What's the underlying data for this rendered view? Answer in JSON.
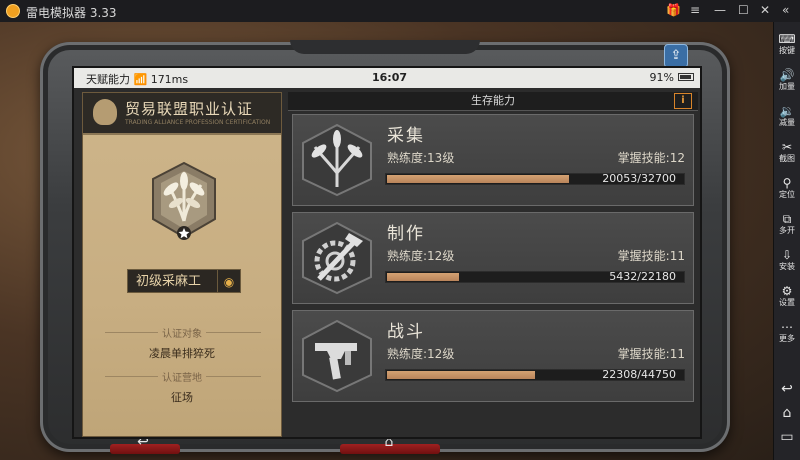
{
  "window": {
    "title": "雷电模拟器 3.33"
  },
  "sidebar": {
    "items": [
      {
        "label": "按键",
        "icon": "keyboard-icon",
        "glyph": "⌨"
      },
      {
        "label": "加量",
        "icon": "volume-up-icon",
        "glyph": "🔊"
      },
      {
        "label": "减量",
        "icon": "volume-down-icon",
        "glyph": "🔉"
      },
      {
        "label": "截图",
        "icon": "scissors-icon",
        "glyph": "✂"
      },
      {
        "label": "定位",
        "icon": "location-pin-icon",
        "glyph": "⚲"
      },
      {
        "label": "多开",
        "icon": "multi-window-icon",
        "glyph": "⧉"
      },
      {
        "label": "安装",
        "icon": "apk-install-icon",
        "glyph": "⇩"
      },
      {
        "label": "设置",
        "icon": "gear-icon",
        "glyph": "⚙"
      },
      {
        "label": "更多",
        "icon": "more-dots-icon",
        "glyph": "⋯"
      }
    ]
  },
  "status": {
    "left": "天赋能力  📶 171ms",
    "time": "16:07",
    "battery": "91%"
  },
  "cert": {
    "title": "贸易联盟职业认证",
    "subtitle": "TRADING ALLIANCE PROFESSION CERTIFICATION",
    "rank": "初级采麻工",
    "target_label": "认证对象",
    "target_value": "凌晨单排猝死",
    "place_label": "认证营地",
    "place_value": "征场"
  },
  "section": {
    "title": "生存能力",
    "info": "i"
  },
  "skills": [
    {
      "name": "采集",
      "prof": "熟练度:13级",
      "tech": "掌握技能:12",
      "current": 20053,
      "max": 32700,
      "progress_text": "20053/32700",
      "icon": "gathering-icon"
    },
    {
      "name": "制作",
      "prof": "熟练度:12级",
      "tech": "掌握技能:11",
      "current": 5432,
      "max": 22180,
      "progress_text": "5432/22180",
      "icon": "crafting-icon"
    },
    {
      "name": "战斗",
      "prof": "熟练度:12级",
      "tech": "掌握技能:11",
      "current": 22308,
      "max": 44750,
      "progress_text": "22308/44750",
      "icon": "combat-icon"
    }
  ],
  "colors": {
    "accent": "#d4a272",
    "frame": "#3b3d3f",
    "panel": "#c8ae82"
  }
}
